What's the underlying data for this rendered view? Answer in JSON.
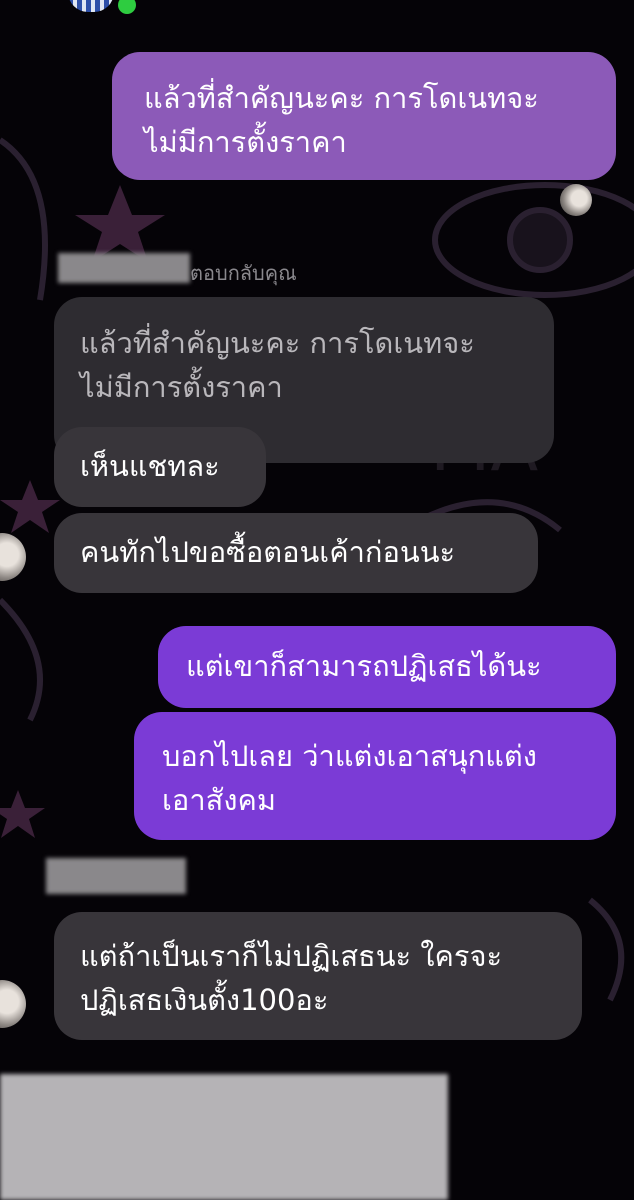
{
  "reply_label": "ตอบกลับคุณ",
  "messages": {
    "m1": [
      "แล้วที่สำคัญนะคะ การโดเนทจะ",
      "ไม่มีการตั้งราคา"
    ],
    "quoted": [
      "แล้วที่สำคัญนะคะ การโดเนทจะ",
      "ไม่มีการตั้งราคา"
    ],
    "m2": "เห็นแชทละ",
    "m3": "คนทักไปขอซื้อตอนเค้าก่อนนะ",
    "m4": "แต่เขาก็สามารถปฏิเสธได้นะ",
    "m5": [
      "บอกไปเลย ว่าแต่งเอาสนุกแต่ง",
      "เอาสังคม"
    ],
    "m6": [
      "แต่ถ้าเป็นเราก็ไม่ปฏิเสธนะ ใครจะ",
      "ปฏิเสธเงินตั้ง100อะ"
    ]
  },
  "colors": {
    "outgoing_bubble": "#7b3bd6",
    "incoming_bubble": "#38353a",
    "background": "#050307",
    "online_dot": "#2ecc40"
  },
  "icons": {
    "online": "online-status-dot",
    "avatar": "user-avatar"
  }
}
